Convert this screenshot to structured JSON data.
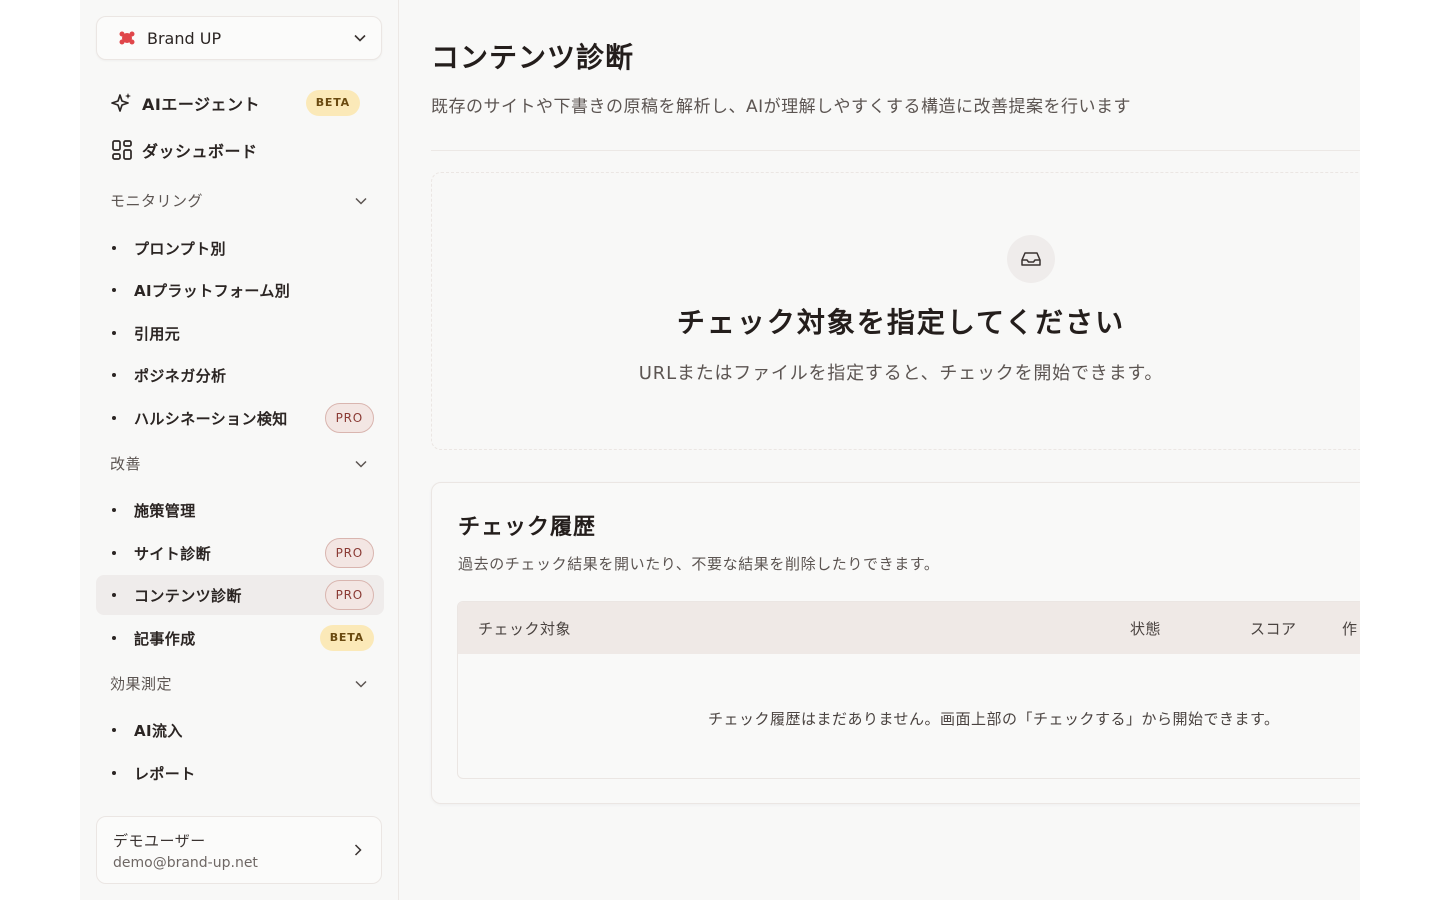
{
  "brand": {
    "name": "Brand UP"
  },
  "nav": {
    "top": [
      {
        "label": "AIエージェント",
        "badge": "BETA",
        "icon": "sparkle-icon"
      },
      {
        "label": "ダッシュボード",
        "icon": "dashboard-grid-icon"
      }
    ],
    "sections": [
      {
        "label": "モニタリング"
      },
      {
        "label": "改善"
      },
      {
        "label": "効果測定"
      }
    ],
    "monitoring": [
      {
        "label": "プロンプト別"
      },
      {
        "label": "AIプラットフォーム別"
      },
      {
        "label": "引用元"
      },
      {
        "label": "ポジネガ分析"
      },
      {
        "label": "ハルシネーション検知",
        "badge": "PRO"
      }
    ],
    "improvement": [
      {
        "label": "施策管理"
      },
      {
        "label": "サイト診断",
        "badge": "PRO"
      },
      {
        "label": "コンテンツ診断",
        "badge": "PRO",
        "active": true
      },
      {
        "label": "記事作成",
        "badge": "BETA"
      }
    ],
    "measurement": [
      {
        "label": "AI流入"
      },
      {
        "label": "レポート"
      }
    ]
  },
  "user": {
    "name": "デモユーザー",
    "email": "demo@brand-up.net"
  },
  "page": {
    "title": "コンテンツ診断",
    "description": "既存のサイトや下書きの原稿を解析し、AIが理解しやすくする構造に改善提案を行います"
  },
  "empty_state": {
    "icon": "inbox-icon",
    "title": "チェック対象を指定してください",
    "subtitle": "URLまたはファイルを指定すると、チェックを開始できます。"
  },
  "history": {
    "title": "チェック履歴",
    "description": "過去のチェック結果を開いたり、不要な結果を削除したりできます。",
    "columns": [
      "チェック対象",
      "状態",
      "スコア",
      "作"
    ],
    "empty_message": "チェック履歴はまだありません。画面上部の「チェックする」から開始できます。"
  },
  "colors": {
    "background": "#f8f8f7",
    "beta_badge": "#fbe9b8",
    "pro_badge": "#f3e6e3",
    "table_header": "#efe9e6"
  }
}
